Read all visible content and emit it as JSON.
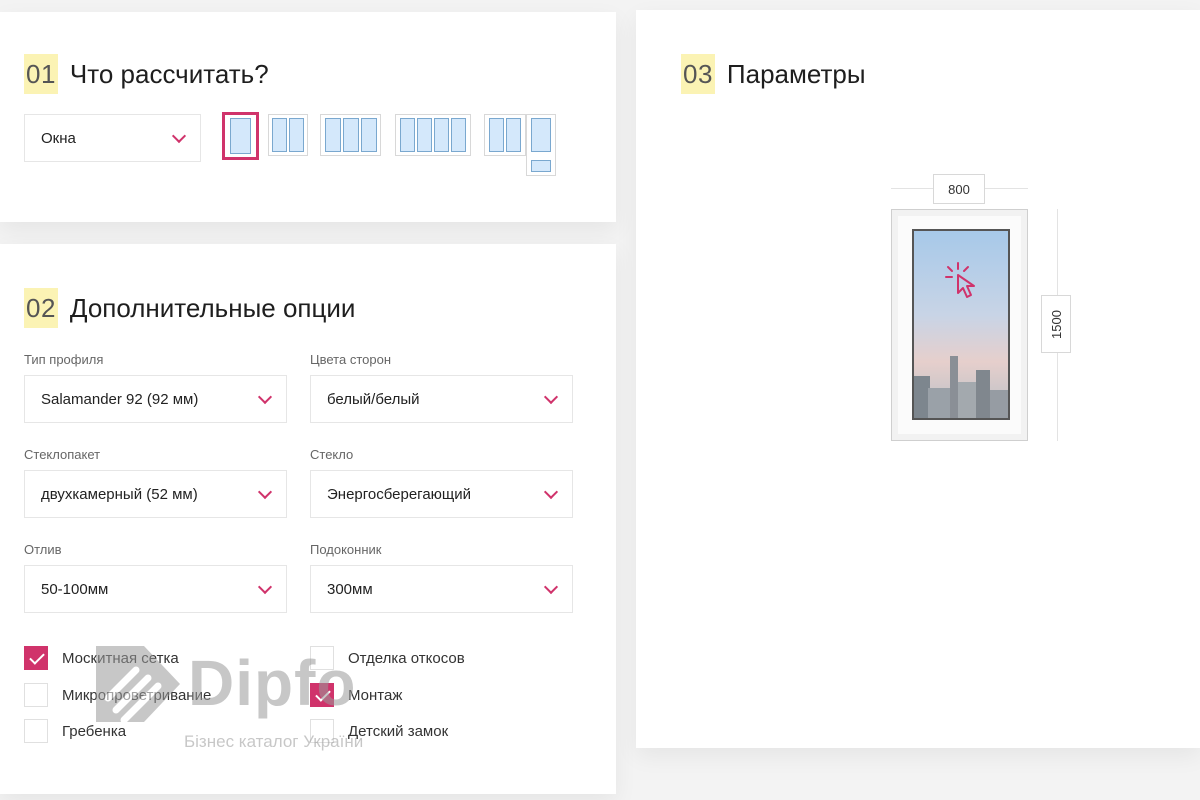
{
  "section1": {
    "number": "01",
    "title": "Что рассчитать?",
    "product_select": "Окна",
    "window_types": [
      {
        "name": "one-sash",
        "panes": 1,
        "selected": true
      },
      {
        "name": "two-sash",
        "panes": 2,
        "selected": false
      },
      {
        "name": "three-sash",
        "panes": 3,
        "selected": false
      },
      {
        "name": "four-sash",
        "panes": 4,
        "selected": false
      },
      {
        "name": "balcony-block",
        "panes": 3,
        "selected": false
      }
    ]
  },
  "section2": {
    "number": "02",
    "title": "Дополнительные опции",
    "fields": {
      "profile": {
        "label": "Тип профиля",
        "value": "Salamander 92 (92 мм)"
      },
      "colors": {
        "label": "Цвета сторон",
        "value": "белый/белый"
      },
      "glazing": {
        "label": "Стеклопакет",
        "value": "двухкамерный (52 мм)"
      },
      "glass": {
        "label": "Стекло",
        "value": "Энергосберегающий"
      },
      "drip": {
        "label": "Отлив",
        "value": "50-100мм"
      },
      "sill": {
        "label": "Подоконник",
        "value": "300мм"
      }
    },
    "options": {
      "mosquito_net": {
        "label": "Москитная сетка",
        "checked": true
      },
      "micro_vent": {
        "label": "Микропроветривание",
        "checked": false
      },
      "comb": {
        "label": "Гребенка",
        "checked": false
      },
      "slopes": {
        "label": "Отделка откосов",
        "checked": false
      },
      "install": {
        "label": "Монтаж",
        "checked": true
      },
      "child_lock": {
        "label": "Детский замок",
        "checked": false
      }
    }
  },
  "section3": {
    "number": "03",
    "title": "Параметры",
    "width": "800",
    "height": "1500"
  },
  "watermark": {
    "brand": "Dipfo",
    "tagline": "Бізнес каталог України"
  },
  "colors": {
    "accent": "#d0336b",
    "number_highlight": "#fbf3b4",
    "pane_fill": "#d4e8fb"
  }
}
